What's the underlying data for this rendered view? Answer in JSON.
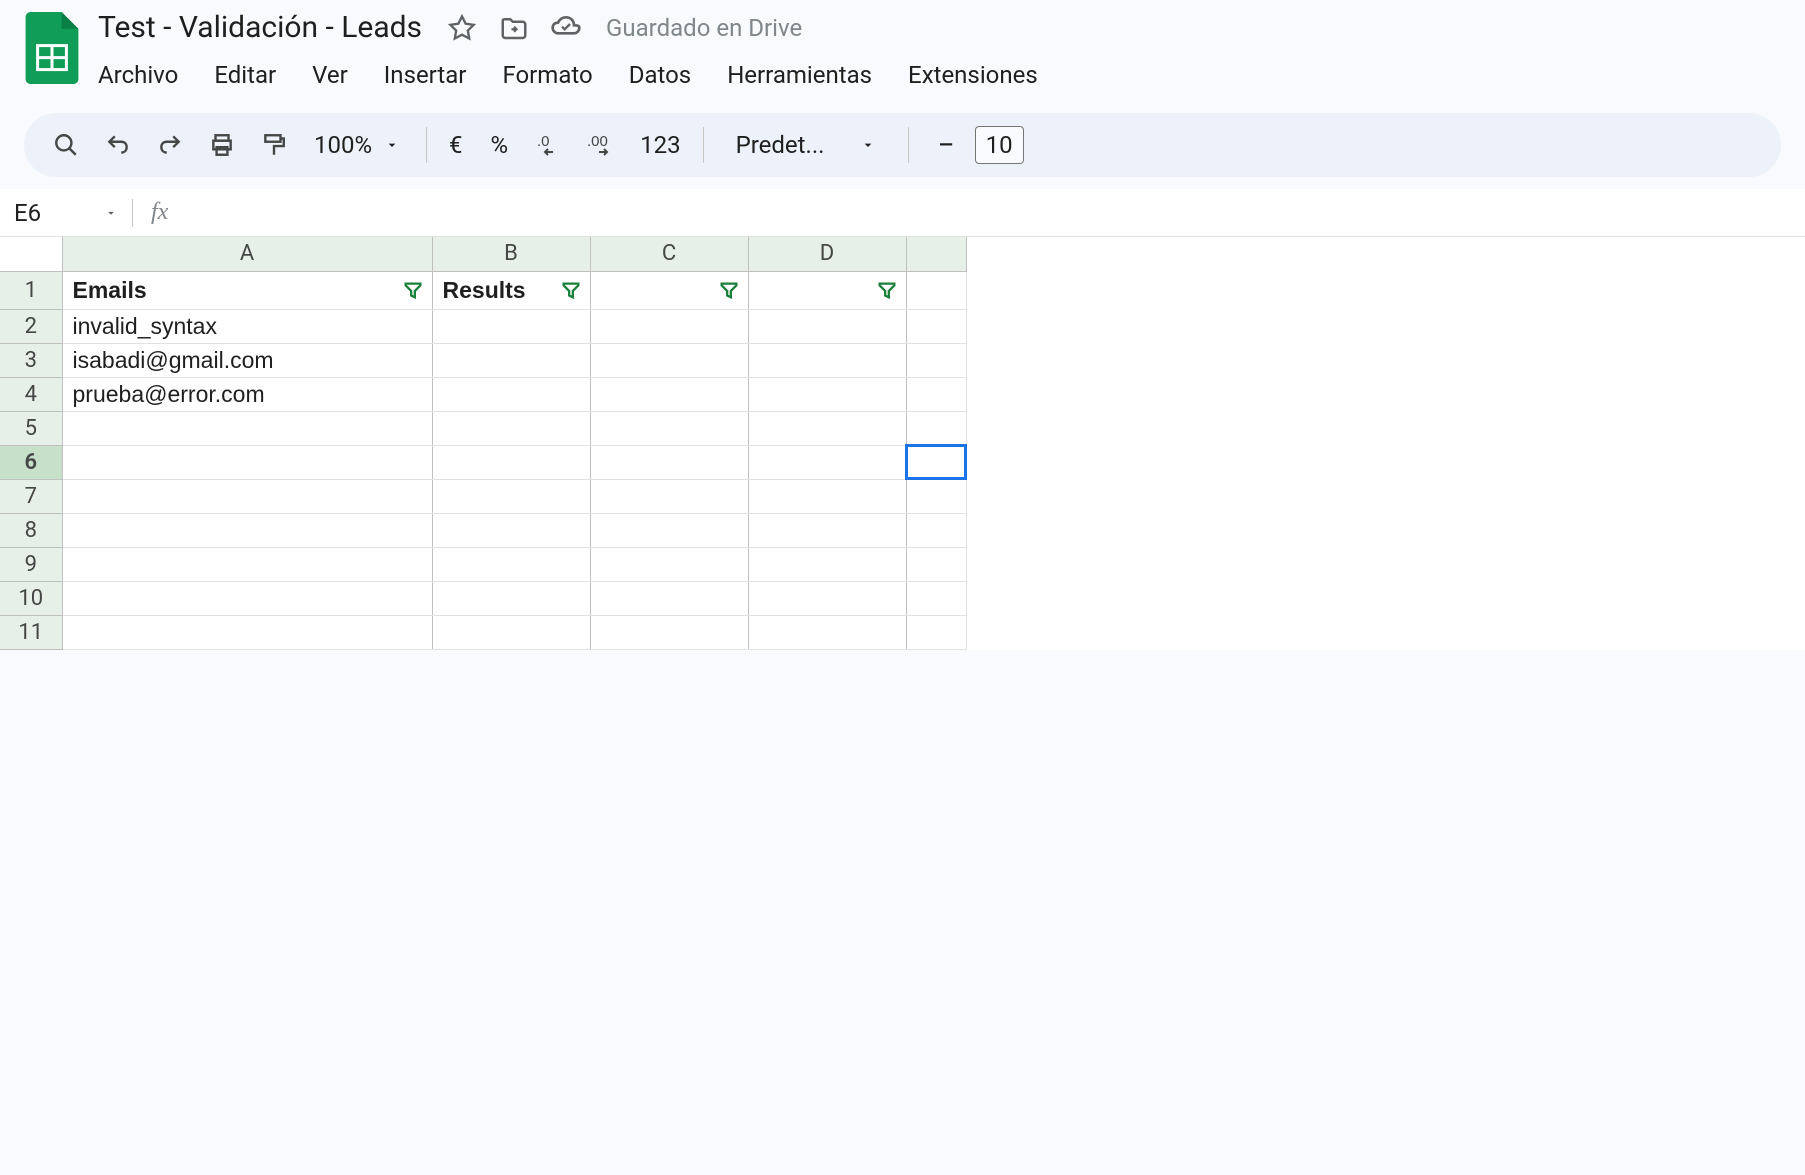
{
  "document": {
    "title": "Test - Validación - Leads",
    "save_status": "Guardado en Drive"
  },
  "menu": {
    "archivo": "Archivo",
    "editar": "Editar",
    "ver": "Ver",
    "insertar": "Insertar",
    "formato": "Formato",
    "datos": "Datos",
    "herramientas": "Herramientas",
    "extensiones": "Extensiones"
  },
  "toolbar": {
    "zoom": "100%",
    "currency": "€",
    "percent": "%",
    "number_format": "123",
    "font_name": "Predet...",
    "font_size": "10",
    "decrease_font": "−"
  },
  "formula_bar": {
    "cell_ref": "E6",
    "fx": "fx",
    "formula": ""
  },
  "columns": [
    "A",
    "B",
    "C",
    "D"
  ],
  "rows": [
    "1",
    "2",
    "3",
    "4",
    "5",
    "6",
    "7",
    "8",
    "9",
    "10",
    "11"
  ],
  "active_row": "6",
  "headers": {
    "A": "Emails",
    "B": "Results"
  },
  "data": {
    "r2": {
      "A": "invalid_syntax"
    },
    "r3": {
      "A": "isabadi@gmail.com"
    },
    "r4": {
      "A": "prueba@error.com"
    }
  }
}
